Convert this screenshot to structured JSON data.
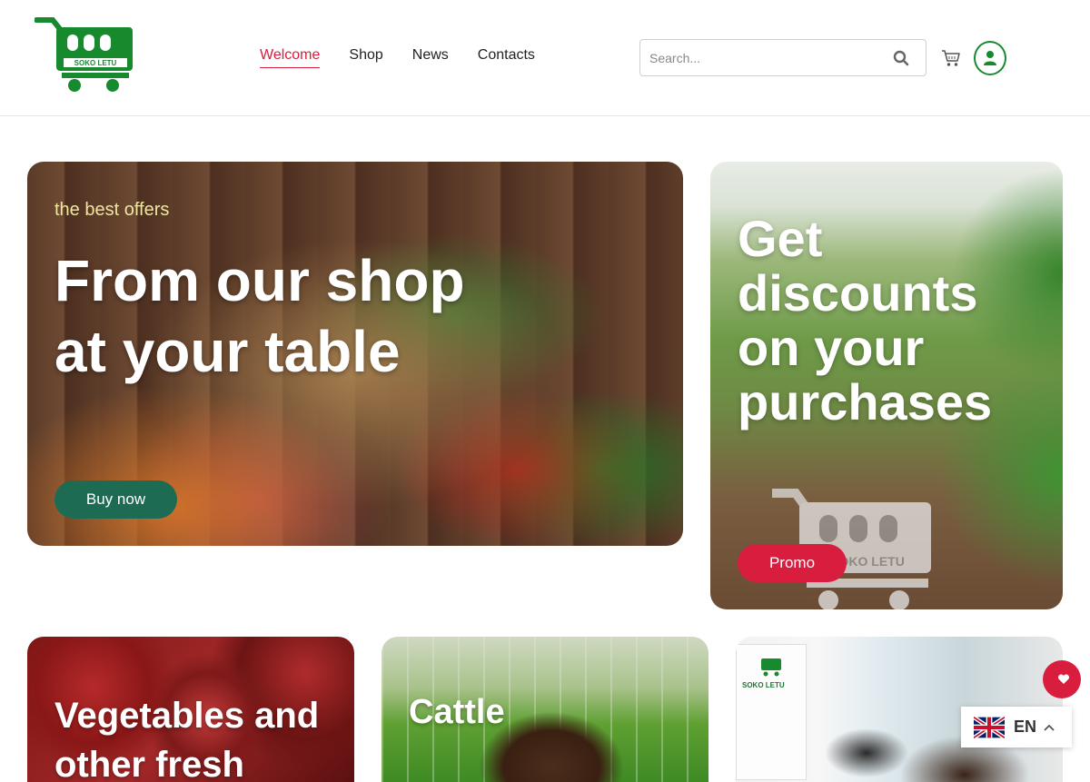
{
  "brand": {
    "logo_text": "SOKO LETU",
    "primary_color": "#178a2e",
    "accent_color": "#d91d3f"
  },
  "nav": {
    "items": [
      {
        "label": "Welcome",
        "active": true
      },
      {
        "label": "Shop",
        "active": false
      },
      {
        "label": "News",
        "active": false
      },
      {
        "label": "Contacts",
        "active": false
      }
    ]
  },
  "search": {
    "placeholder": "Search...",
    "value": "",
    "icon": "search-icon"
  },
  "header_icons": {
    "cart": "cart-icon",
    "account": "user-icon"
  },
  "hero_main": {
    "kicker": "the best offers",
    "title": "From our shop at your table",
    "button_label": "Buy now",
    "button_color": "#1d6b52"
  },
  "hero_promo": {
    "title": "Get discounts on your purchases",
    "button_label": "Promo",
    "watermark_text": "SOKO LETU"
  },
  "categories": [
    {
      "title": "Vegetables and other fresh"
    },
    {
      "title": "Cattle"
    },
    {
      "title": "",
      "poster_text": "SOKO LETU"
    }
  ],
  "language": {
    "code": "EN",
    "flag": "uk-flag-icon"
  }
}
